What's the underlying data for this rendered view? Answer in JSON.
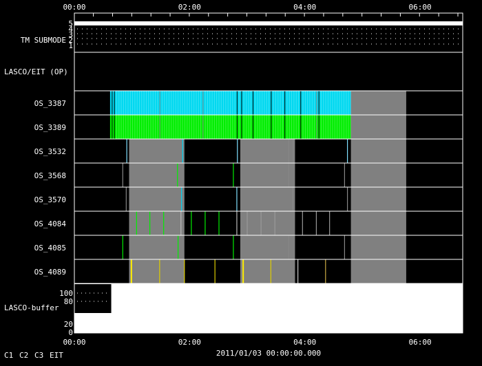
{
  "chart_data": {
    "type": "timeline",
    "date_label": "2011/01/03 00:00:00.000",
    "x_range_hours": [
      0,
      6.74
    ],
    "x_ticks": [
      "00:00",
      "02:00",
      "04:00",
      "06:00"
    ],
    "tm_submode": {
      "label": "TM SUBMODE",
      "levels": [
        "5",
        "4",
        "3",
        "2",
        "1"
      ],
      "value": 5
    },
    "lasco_eit_op": {
      "label": "LASCO/EIT (OP)"
    },
    "gray_blocks_hours": [
      [
        0.95,
        1.91
      ],
      [
        2.88,
        3.83
      ],
      [
        4.8,
        5.76
      ]
    ],
    "rows": [
      {
        "label": "OS_3387",
        "fill": {
          "from": 0.62,
          "to": 4.8,
          "color": "#00d8f0"
        },
        "gray": [
          [
            4.8,
            5.76
          ]
        ],
        "marks": []
      },
      {
        "label": "OS_3389",
        "fill": {
          "from": 0.62,
          "to": 4.8,
          "color": "#00ee00"
        },
        "gray": [
          [
            4.8,
            5.76
          ]
        ],
        "marks": []
      },
      {
        "label": "OS_3532",
        "marks": [
          [
            0.91,
            "#80e0ff"
          ],
          [
            1.88,
            "#00d0f0"
          ],
          [
            2.83,
            "#80e0ff"
          ],
          [
            3.72,
            "#888888"
          ],
          [
            3.8,
            "#888888"
          ],
          [
            4.74,
            "#80e0ff"
          ]
        ]
      },
      {
        "label": "OS_3568",
        "marks": [
          [
            0.84,
            "#888888"
          ],
          [
            1.79,
            "#00ee00"
          ],
          [
            2.76,
            "#00ee00"
          ],
          [
            3.72,
            "#888888"
          ],
          [
            4.69,
            "#888888"
          ]
        ]
      },
      {
        "label": "OS_3570",
        "marks": [
          [
            0.9,
            "#888888"
          ],
          [
            1.86,
            "#00d0f0"
          ],
          [
            2.82,
            "#80e0ff"
          ],
          [
            3.79,
            "#888888"
          ],
          [
            4.74,
            "#888888"
          ]
        ]
      },
      {
        "label": "OS_4084",
        "marks": [
          [
            1.08,
            "#00ee00"
          ],
          [
            1.31,
            "#00ee00"
          ],
          [
            1.55,
            "#00ee00"
          ],
          [
            1.85,
            "#bbbbbb"
          ],
          [
            2.03,
            "#00ee00"
          ],
          [
            2.27,
            "#00ee00"
          ],
          [
            2.51,
            "#00ee00"
          ],
          [
            2.82,
            "#bbbbbb"
          ],
          [
            3.0,
            "#999999"
          ],
          [
            3.24,
            "#999999"
          ],
          [
            3.48,
            "#999999"
          ],
          [
            3.96,
            "#999999"
          ],
          [
            4.2,
            "#999999"
          ],
          [
            4.43,
            "#999999"
          ]
        ]
      },
      {
        "label": "OS_4085",
        "marks": [
          [
            0.84,
            "#00ee00"
          ],
          [
            1.8,
            "#00ee00"
          ],
          [
            2.76,
            "#00ee00"
          ],
          [
            3.72,
            "#888888"
          ],
          [
            4.69,
            "#888888"
          ]
        ]
      },
      {
        "label": "OS_4089",
        "marks": [
          [
            0.99,
            "#ffee00"
          ],
          [
            1.48,
            "#ddcc00"
          ],
          [
            1.91,
            "#ddcc00"
          ],
          [
            2.44,
            "#ddcc00"
          ],
          [
            2.93,
            "#ffee00"
          ],
          [
            3.41,
            "#ddcc00"
          ],
          [
            3.88,
            "#cccccc"
          ],
          [
            4.36,
            "#ccaa44"
          ]
        ]
      }
    ],
    "buffer": {
      "label": "LASCO-buffer",
      "ticks": [
        "100",
        "80",
        "20",
        "0"
      ],
      "empty_until_hours": 0.64
    },
    "legend": [
      {
        "label": "C1",
        "color": "#ff2020"
      },
      {
        "label": "C2",
        "color": "#00ee00"
      },
      {
        "label": "C3",
        "color": "#90e0f0"
      },
      {
        "label": "EIT",
        "color": "#ffee00"
      }
    ]
  }
}
